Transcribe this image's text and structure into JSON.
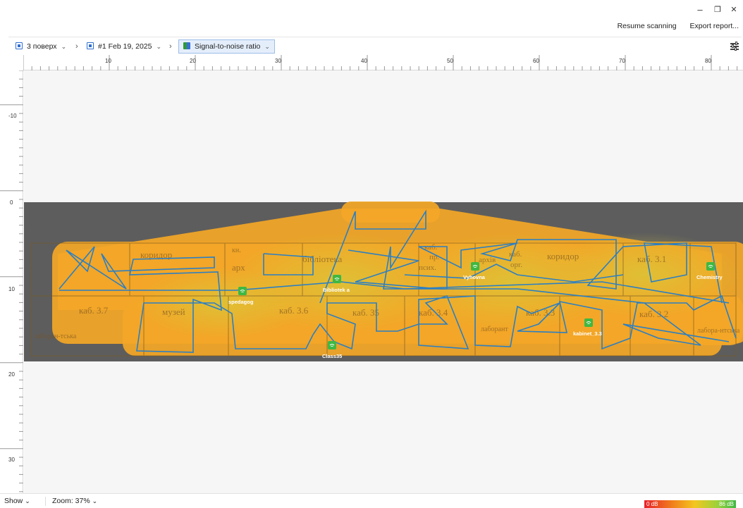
{
  "window": {
    "minimize_glyph": "–",
    "maximize_glyph": "❐",
    "close_glyph": "✕"
  },
  "actions": {
    "resume_scanning": "Resume scanning",
    "export_report": "Export report..."
  },
  "breadcrumb": {
    "floor": "3 поверх",
    "survey": "#1 Feb 19, 2025",
    "visualization": "Signal-to-noise ratio"
  },
  "ruler": {
    "x_ticks": [
      "10",
      "20",
      "30",
      "40",
      "50",
      "60",
      "70",
      "80"
    ],
    "y_ticks": [
      "-10",
      "0",
      "10",
      "20",
      "30"
    ]
  },
  "floorplan": {
    "room_labels": [
      "коридор",
      "кн.",
      "арх",
      "бібліотека",
      "каб.",
      "пр.",
      "псих.",
      "архів",
      "каб.",
      "орг.",
      "коридор",
      "каб. 3.1",
      "каб. 3.7",
      "музей",
      "каб. 3.6",
      "каб. 35",
      "каб. 3.4",
      "лаборант",
      "каб. 3.3",
      "каб. 3.2",
      "лабора-нтська",
      "лаборан-тська"
    ],
    "access_points": [
      {
        "name": "Bibliotek a"
      },
      {
        "name": "spedagog"
      },
      {
        "name": "Vyhovna"
      },
      {
        "name": "Chemistry"
      },
      {
        "name": "Class35"
      },
      {
        "name": "kabinet_3.3"
      }
    ]
  },
  "status": {
    "show": "Show",
    "zoom": "Zoom: 37%"
  },
  "legend": {
    "min": "0 dB",
    "max": "86 dB"
  },
  "colors": {
    "heat_orange": "#f5a623",
    "heat_yellow": "#e6b92e",
    "path_blue": "#2a7fc4",
    "ap_green": "#3fb843",
    "accent_blue": "#2f6fd0"
  }
}
